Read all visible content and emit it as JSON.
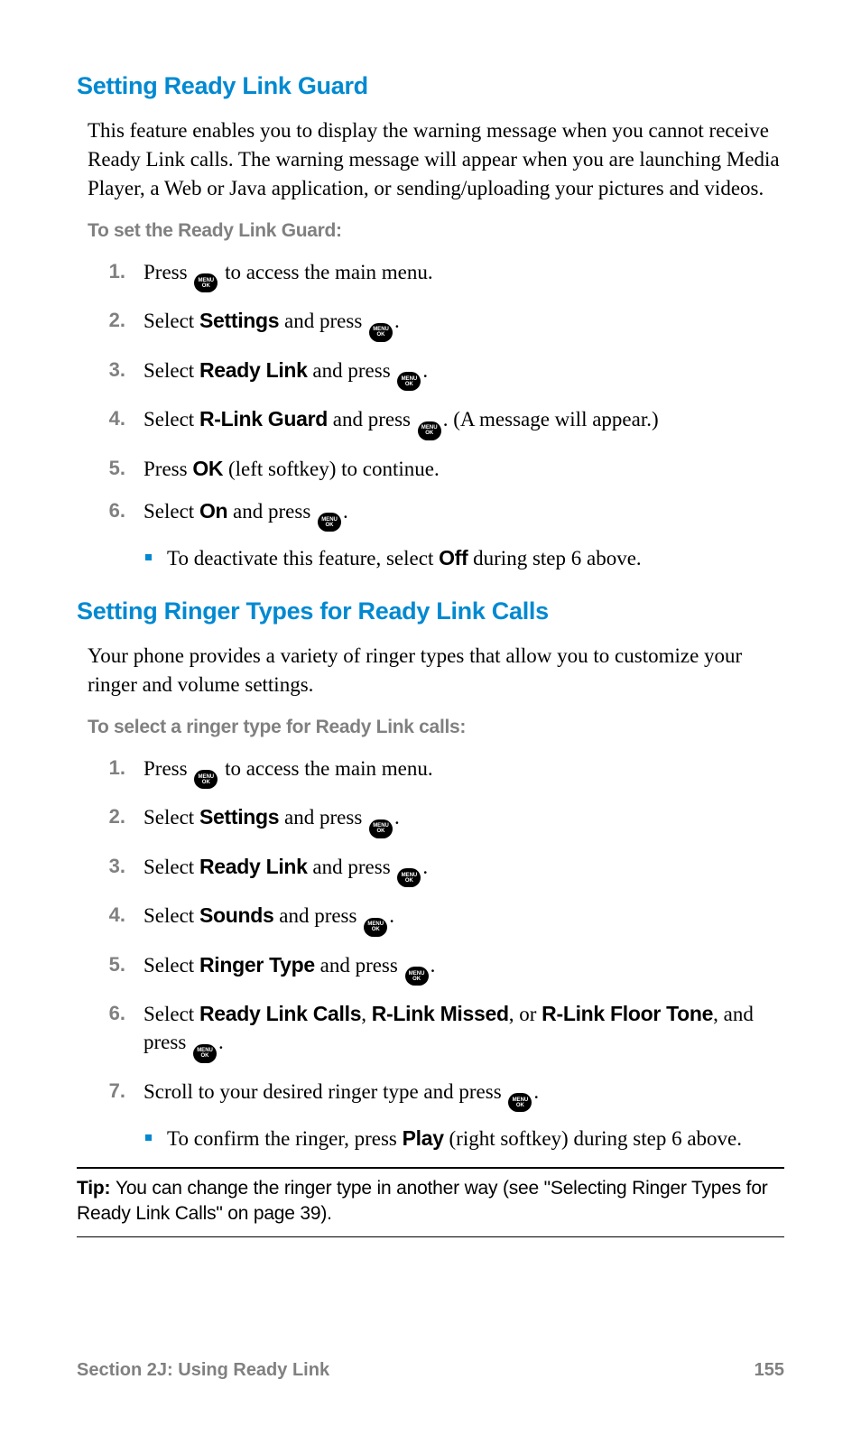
{
  "section1": {
    "heading": "Setting Ready Link Guard",
    "intro": "This feature enables you to display the warning message when you cannot receive Ready Link calls. The warning message will appear when you are launching Media Player, a Web or Java application, or sending/uploading your pictures and videos.",
    "subhead": "To set the Ready Link Guard:",
    "steps": {
      "s1a": "Press ",
      "s1b": " to access the main menu.",
      "s2a": "Select ",
      "s2bold": "Settings",
      "s2b": " and press ",
      "s2c": ".",
      "s3a": "Select ",
      "s3bold": "Ready Link",
      "s3b": " and press ",
      "s3c": ".",
      "s4a": "Select ",
      "s4bold": "R-Link Guard",
      "s4b": " and press ",
      "s4c": ". (A message will appear.)",
      "s5a": "Press ",
      "s5bold": "OK",
      "s5b": " (left softkey) to continue.",
      "s6a": "Select ",
      "s6bold": "On",
      "s6b": " and press ",
      "s6c": ".",
      "s6bul_a": "To deactivate this feature, select ",
      "s6bul_bold": "Off",
      "s6bul_b": " during step 6 above."
    }
  },
  "section2": {
    "heading": "Setting Ringer Types for Ready Link Calls",
    "intro": "Your phone provides a variety of ringer types that allow you to customize your ringer and volume settings.",
    "subhead": "To select a ringer type for Ready Link calls:",
    "steps": {
      "s1a": "Press ",
      "s1b": " to access the main menu.",
      "s2a": "Select ",
      "s2bold": "Settings",
      "s2b": " and press ",
      "s2c": ".",
      "s3a": "Select ",
      "s3bold": "Ready Link",
      "s3b": " and press ",
      "s3c": ".",
      "s4a": "Select ",
      "s4bold": "Sounds",
      "s4b": " and press ",
      "s4c": ".",
      "s5a": "Select ",
      "s5bold": "Ringer Type",
      "s5b": " and press ",
      "s5c": ".",
      "s6a": "Select ",
      "s6bold1": "Ready Link Calls",
      "s6sep1": ", ",
      "s6bold2": "R-Link Missed",
      "s6sep2": ", or ",
      "s6bold3": "R-Link Floor Tone",
      "s6b": ", and press ",
      "s6c": ".",
      "s7a": "Scroll to your desired ringer type and press ",
      "s7b": ".",
      "s7bul_a": "To confirm the ringer, press ",
      "s7bul_bold": "Play",
      "s7bul_b": " (right softkey) during step 6 above."
    }
  },
  "tip": {
    "label": "Tip: ",
    "text": "You can change the ringer type in another way (see \"Selecting Ringer Types for Ready Link Calls\" on page 39)."
  },
  "footer": {
    "section": "Section 2J: Using Ready Link",
    "page": "155"
  },
  "icon_label": "MENU\nOK"
}
